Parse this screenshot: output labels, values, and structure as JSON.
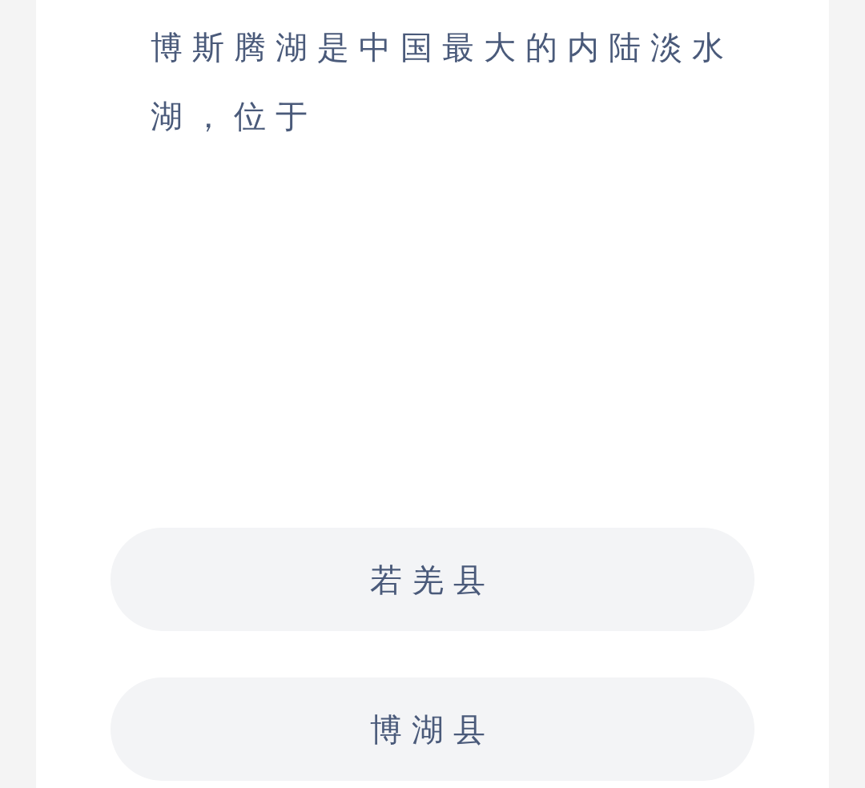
{
  "question": "博斯腾湖是中国最大的内陆淡水湖，位于",
  "options": [
    {
      "label": "若羌县"
    },
    {
      "label": "博湖县"
    }
  ]
}
